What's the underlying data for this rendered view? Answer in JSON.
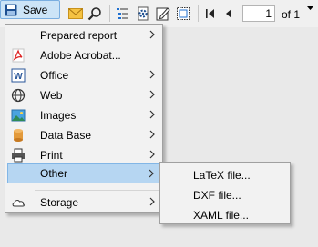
{
  "toolbar": {
    "save_label": "Save",
    "page_number": "1",
    "of_label": "of 1"
  },
  "menu": {
    "items": [
      {
        "label": "Prepared report",
        "icon": "blank"
      },
      {
        "label": "Adobe Acrobat...",
        "icon": "pdf-icon"
      },
      {
        "label": "Office",
        "icon": "word-icon"
      },
      {
        "label": "Web",
        "icon": "globe-icon"
      },
      {
        "label": "Images",
        "icon": "image-icon"
      },
      {
        "label": "Data Base",
        "icon": "database-icon"
      },
      {
        "label": "Print",
        "icon": "printer-icon"
      },
      {
        "label": "Other",
        "icon": "blank"
      },
      {
        "label": "Storage",
        "icon": "cloud-icon"
      }
    ]
  },
  "submenu": {
    "items": [
      {
        "label": "LaTeX file..."
      },
      {
        "label": "DXF file..."
      },
      {
        "label": "XAML file..."
      }
    ]
  },
  "colors": {
    "selected_bg": "#b6d6f2",
    "save_button_bg": "#cce4f7",
    "menu_bg": "#f2f2f2"
  }
}
